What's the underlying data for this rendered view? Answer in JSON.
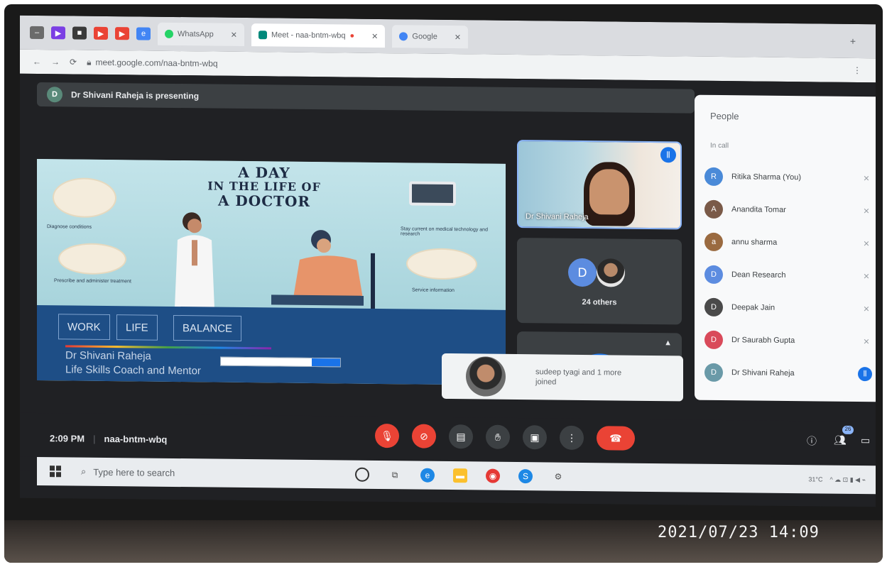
{
  "browser": {
    "tabs": [
      {
        "label": "WhatsApp",
        "icon": "whatsapp-icon",
        "color": "#25d366"
      },
      {
        "label": "Meet - naa-bntm-wbq",
        "icon": "meet-icon",
        "color": "#00897b"
      },
      {
        "label": "Google",
        "icon": "google-icon",
        "color": "#4285f4"
      }
    ],
    "url": "meet.google.com/naa-bntm-wbq"
  },
  "meet": {
    "presenting_text": "Dr Shivani Raheja is presenting",
    "presenter_initial": "D",
    "slide": {
      "title_lines": [
        "A DAY",
        "IN THE LIFE OF",
        "A DOCTOR"
      ],
      "captions": [
        "Diagnose conditions",
        "Stay current on medical technology and research",
        "Prescribe and administer treatment",
        "Service information"
      ],
      "tags": [
        "WORK",
        "LIFE",
        "BALANCE"
      ],
      "presenter_name": "Dr Shivani Raheja",
      "presenter_role": "Life Skills Coach and Mentor"
    },
    "tiles": {
      "main_speaker": "Dr Shivani Raheja",
      "group_initial": "D",
      "group_label": "24 others"
    },
    "toast_text": "sudeep tyagi and 1 more joined",
    "meeting_time": "2:09 PM",
    "meeting_code": "naa-bntm-wbq",
    "participant_count": "26"
  },
  "people": {
    "title": "People",
    "section": "In call",
    "participants": [
      {
        "name": "Ritika Sharma (You)",
        "initial": "R",
        "color": "#4a8ad8"
      },
      {
        "name": "Anandita Tomar",
        "initial": "A",
        "color": "#7a5a48"
      },
      {
        "name": "annu sharma",
        "initial": "a",
        "color": "#9a6a40"
      },
      {
        "name": "Dean Research",
        "initial": "D",
        "color": "#5c8ce0"
      },
      {
        "name": "Deepak Jain",
        "initial": "D",
        "color": "#4a4a4a"
      },
      {
        "name": "Dr Saurabh Gupta",
        "initial": "D",
        "color": "#d94a5a"
      },
      {
        "name": "Dr Shivani Raheja",
        "initial": "D",
        "color": "#6a9aa8"
      }
    ]
  },
  "taskbar": {
    "search_placeholder": "Type here to search",
    "weather": "31°C"
  },
  "photo_timestamp": "2021/07/23  14:09"
}
